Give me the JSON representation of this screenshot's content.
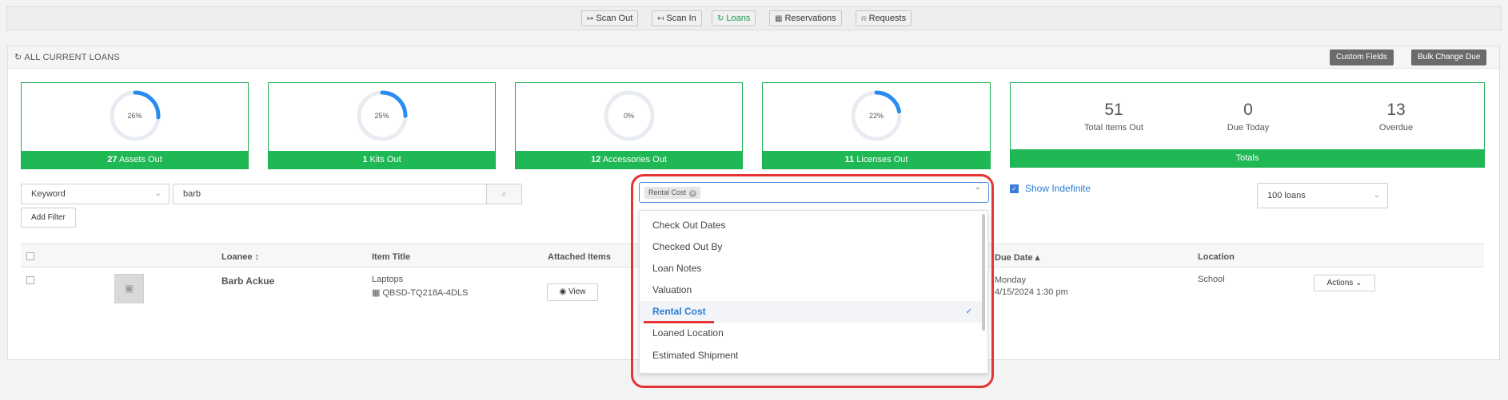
{
  "nav": {
    "buttons": [
      {
        "label": "Scan Out",
        "icon": "sign-out-icon"
      },
      {
        "label": "Scan In",
        "icon": "sign-in-icon"
      },
      {
        "label": "Loans",
        "icon": "refresh-icon"
      },
      {
        "label": "Reservations",
        "icon": "calendar-icon"
      },
      {
        "label": "Requests",
        "icon": "bell-icon"
      }
    ],
    "active": "Loans",
    "accent_color": "#1a9c48"
  },
  "panel": {
    "title": "ALL CURRENT LOANS",
    "custom_fields_label": "Custom Fields",
    "bulk_change_label": "Bulk Change Due"
  },
  "stats": [
    {
      "percent_label": "26%",
      "percent": 26,
      "count": "27",
      "label": "Assets Out"
    },
    {
      "percent_label": "25%",
      "percent": 25,
      "count": "1",
      "label": "Kits Out"
    },
    {
      "percent_label": "0%",
      "percent": 0,
      "count": "12",
      "label": "Accessories Out"
    },
    {
      "percent_label": "22%",
      "percent": 22,
      "count": "11",
      "label": "Licenses Out"
    }
  ],
  "totals": {
    "total_items_out": "51",
    "total_items_out_label": "Total Items Out",
    "due_today": "0",
    "due_today_label": "Due Today",
    "overdue": "13",
    "overdue_label": "Overdue",
    "footer": "Totals"
  },
  "filters": {
    "field_select": "Keyword",
    "search_value": "barb",
    "add_filter_label": "Add Filter",
    "column_tag": "Rental Cost",
    "show_indefinite_label": "Show Indefinite",
    "show_indefinite_checked": true,
    "page_size": "100 loans"
  },
  "table": {
    "headers": [
      "Loanee",
      "Item Title",
      "Attached Items",
      "Due Date",
      "Location"
    ],
    "rows": [
      {
        "loanee": "Barb Ackue",
        "item_title": "Laptops",
        "item_code": "QBSD-TQ218A-4DLS",
        "view_label": "View",
        "due_day": "Monday",
        "due_date": "4/15/2024 1:30 pm",
        "location": "School",
        "actions_label": "Actions"
      }
    ]
  },
  "column_menu": {
    "items": [
      "Check Out Dates",
      "Checked Out By",
      "Loan Notes",
      "Valuation",
      "Rental Cost",
      "Loaned Location",
      "Estimated Shipment"
    ],
    "selected": "Rental Cost"
  }
}
